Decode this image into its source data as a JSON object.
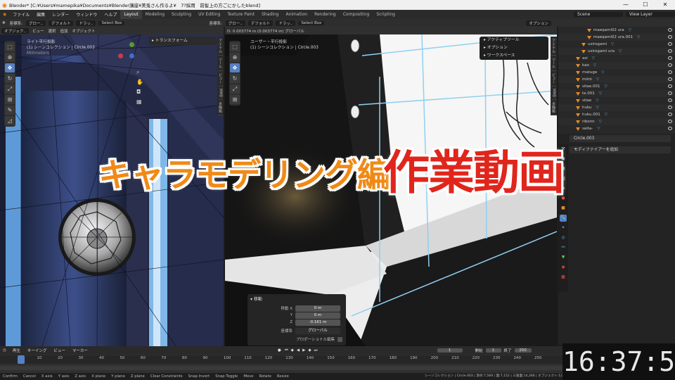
{
  "window": {
    "title": "Blender* [C:¥Users¥mamepika¥Documents¥Blender講座¥美兎さん作るよ¥　7?採用　前髪上の方ごにかしたblend]",
    "controls": [
      "—",
      "☐",
      "✕"
    ]
  },
  "menu": {
    "items": [
      "ファイル",
      "編集",
      "レンダー",
      "ウィンドウ",
      "ヘルプ"
    ],
    "workspaces": [
      "Layout",
      "Modeling",
      "Sculpting",
      "UV Editing",
      "Texture Paint",
      "Shading",
      "Animation",
      "Rendering",
      "Compositing",
      "Scripting"
    ],
    "active_workspace": "Layout",
    "scene_label": "Scene",
    "view_layer_label": "View Layer"
  },
  "viewport_left": {
    "header": [
      "オブジェク..",
      "ビュー",
      "選択",
      "追加",
      "オブジェクト"
    ],
    "coord_label": "座標系:",
    "coord_value": "グロー..",
    "pivot_label": "デフォルト",
    "snap_label": "ドラッ..",
    "select_box": "Select Box",
    "info_line1": "ライト平行投影",
    "info_line2": "(1) シーンコレクション | Circle.003",
    "info_line3": "Millimeters",
    "transform_panel": "トランスフォーム",
    "sidetabs": [
      "アイテム",
      "ツール",
      "ビュー",
      "MMD",
      "多機能"
    ]
  },
  "viewport_right": {
    "header_info": "D: 0.003774 m (0.003774 m) グローバル",
    "coord_label": "座標系:",
    "coord_value": "グロー..",
    "pivot_label": "デフォルト",
    "snap_label": "ドラッ..",
    "select_box": "Select Box",
    "options_label": "オプション",
    "info_line1": "ユーザー・平行投影",
    "info_line2": "(1) シーンコレクション | Circle.003",
    "popup_items": [
      "アクティブツール",
      "オプション",
      "ワークスペース"
    ],
    "sidetabs": [
      "アイテム",
      "ツール",
      "ビュー",
      "MMD",
      "多機能"
    ]
  },
  "move_panel": {
    "title": "移動",
    "fields": [
      {
        "label": "移動 X",
        "value": "0 m"
      },
      {
        "label": "Y",
        "value": "0 m"
      },
      {
        "label": "Z",
        "value": "-0.161 m"
      }
    ],
    "orient_label": "座標系",
    "orient_value": "グローバル",
    "proportional_label": "プロポーショナル編集"
  },
  "overlay_title": {
    "part1": "キャラモデリング編",
    "part2": "作業動画"
  },
  "outliner": {
    "rows": [
      {
        "name": "maeqami02 ura",
        "indent": 2
      },
      {
        "name": "maeqami02 ura.001",
        "indent": 2
      },
      {
        "name": "usirogami",
        "indent": 1
      },
      {
        "name": "usirogami ura",
        "indent": 1
      },
      {
        "name": "asi",
        "indent": 0
      },
      {
        "name": "kao",
        "indent": 0
      },
      {
        "name": "matuge",
        "indent": 0
      },
      {
        "name": "mimi",
        "indent": 0
      },
      {
        "name": "sitae.001",
        "indent": 0
      },
      {
        "name": "te.001",
        "indent": 0
      },
      {
        "name": "sitae",
        "indent": 0
      },
      {
        "name": "huku",
        "indent": 0
      },
      {
        "name": "huku.001",
        "indent": 0
      },
      {
        "name": "ribonn",
        "indent": 0
      },
      {
        "name": "seita-",
        "indent": 0
      }
    ]
  },
  "properties": {
    "object_name": "Circle.003",
    "add_modifier": "モディファイアーを追加"
  },
  "timeline": {
    "header": [
      "再生",
      "キーイング",
      "ビュー",
      "マーカー"
    ],
    "current_frame": "1",
    "start_label": "開始",
    "start_value": "1",
    "end_label": "終了",
    "end_value": "250",
    "ruler_ticks": [
      "1",
      "10",
      "20",
      "30",
      "40",
      "50",
      "60",
      "70",
      "80",
      "90",
      "100",
      "110",
      "120",
      "130",
      "140",
      "150",
      "160",
      "170",
      "180",
      "190",
      "200",
      "210",
      "220",
      "230",
      "240",
      "250"
    ]
  },
  "statusbar": {
    "items": [
      "Confirm",
      "Cancel",
      "X axis",
      "Y axis",
      "Z axis",
      "X plane",
      "Y plane",
      "Z plane",
      "Clear Constraints",
      "Snap Invert",
      "Snap Toggle",
      "Move",
      "Rotate",
      "Resize"
    ],
    "right": "シーンコレクション | Circle.003 | 頂点:7,569 | 面:7,152 | 三角面:14,366 | オブジェクト:1/24 | メモリ:82.7 MiB | v2.82.7"
  },
  "clock": "16:37:57",
  "colors": {
    "accent": "#5680c2",
    "title_orange": "#f08a16",
    "title_red": "#e0261c"
  }
}
